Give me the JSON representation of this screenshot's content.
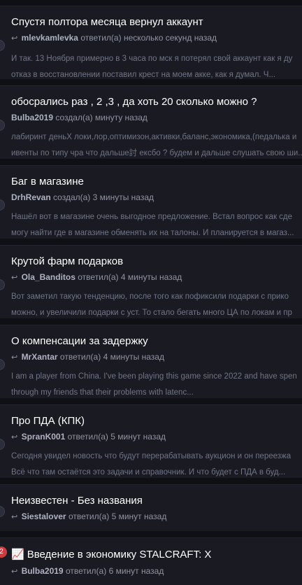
{
  "topics": [
    {
      "title": "Спустя полтора месяца вернул аккаунт",
      "author": "mlevkamlevka",
      "action": "ответил(а)",
      "time": "несколько секунд назад",
      "excerpt": [
        "И так. 13 Ноября примерно в 3 часа по мск я потерял свой аккаунт как я ду",
        "отказ в восстановлении поставил крест на моем акке, как я думал. Ч..."
      ]
    },
    {
      "title": "обосрались раз , 2 ,3 , да хоть 20 сколько можно ?",
      "author": "Bulba2019",
      "action": "создал(а)",
      "time": "минуту назад",
      "excerpt": [
        "лабиринт деньХ локи,лор,оптимизон,активки,баланс,экономика,(педалька и",
        "ивенты по типу чра что дальше討 ексбо ? будем и дальше слушать свою ши..."
      ]
    },
    {
      "title": "Баг в магазине",
      "author": "DrhRevan",
      "action": "создал(а)",
      "time": "3 минуты назад",
      "excerpt": [
        "Нашёл вот в магазине очень выгодное предложение. Встал вопрос как сде",
        "могу найти где в магазине обменять их на талоны. И планируется в магаз..."
      ]
    },
    {
      "title": "Крутой фарм подарков",
      "author": "Ola_Banditos",
      "action": "ответил(а)",
      "time": "4 минуты назад",
      "excerpt": [
        "Вот заметил такую тенденцию, после того как пофиксили подарки с прико",
        "можно, и увеличили подарки с уст. То стало бегать много ЦА по локам и пр"
      ]
    },
    {
      "title": "О компенсации за задержку",
      "author": "MrXantar",
      "action": "ответил(а)",
      "time": "4 минуты назад",
      "excerpt": [
        "I am a player from China. I've been playing this game since 2022 and have spen",
        "through my friends that their problems with latenc..."
      ]
    },
    {
      "title": "Про ПДА (КПК)",
      "author": "SpranK001",
      "action": "ответил(а)",
      "time": "5 минут назад",
      "excerpt": [
        "Сегодня увидел новость что будут перерабатывать аукцион и он переезжа",
        "Всё что там остаётся это задачи и справочник. И что будет с ПДА в буд..."
      ]
    },
    {
      "title": "Неизвестен - Без названия",
      "author": "Siestalover",
      "action": "ответил(а)",
      "time": "5 минут назад",
      "excerpt": []
    },
    {
      "title": "Введение в экономику STALCRAFT: X",
      "author": "Bulba2019",
      "action": "ответил(а)",
      "time": "6 минут назад",
      "excerpt": []
    }
  ],
  "badge_count": "2",
  "icons": {
    "reply": "reply-arrow-icon",
    "chart": "chart-increasing-icon"
  },
  "colors": {
    "background": "#0f1014",
    "card": "#191a22",
    "badge": "#d3393f"
  }
}
